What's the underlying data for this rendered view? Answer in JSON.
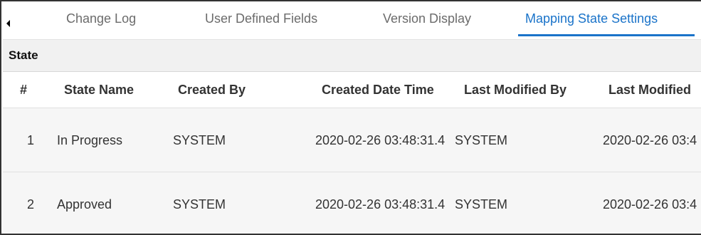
{
  "tabs": [
    {
      "label": "Change Log",
      "active": false
    },
    {
      "label": "User Defined Fields",
      "active": false
    },
    {
      "label": "Version Display",
      "active": false
    },
    {
      "label": "Mapping State Settings",
      "active": true
    }
  ],
  "section": {
    "title": "State"
  },
  "table": {
    "columns": [
      "#",
      "State Name",
      "Created By",
      "Created Date Time",
      "Last Modified By",
      "Last Modified"
    ],
    "rows": [
      [
        "1",
        "In Progress",
        "SYSTEM",
        "2020-02-26 03:48:31.4",
        "SYSTEM",
        "2020-02-26 03:4"
      ],
      [
        "2",
        "Approved",
        "SYSTEM",
        "2020-02-26 03:48:31.4",
        "SYSTEM",
        "2020-02-26 03:4"
      ]
    ]
  },
  "colors": {
    "accent": "#1a73c9",
    "header_bg": "#f1f1f1",
    "row_bg": "#f6f6f6"
  }
}
